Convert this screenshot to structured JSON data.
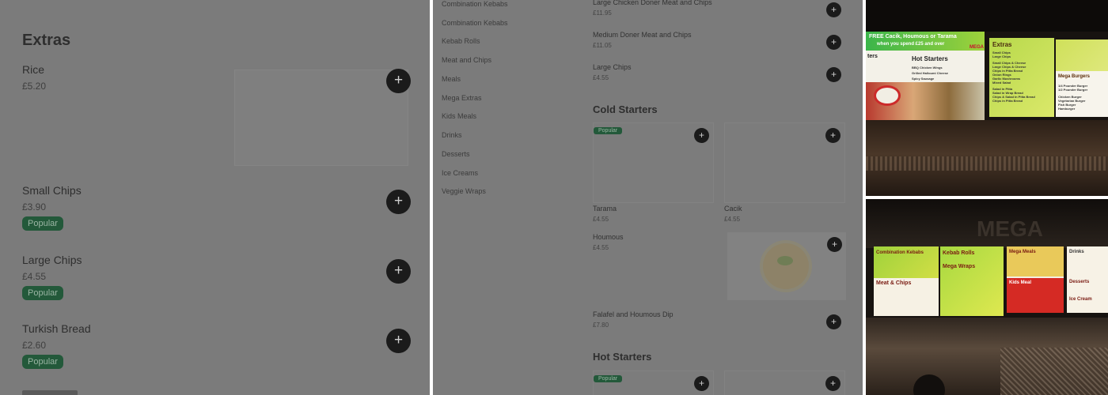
{
  "panel1": {
    "section_title": "Extras",
    "items": [
      {
        "name": "Rice",
        "price": "£5.20",
        "badge": ""
      },
      {
        "name": "Small Chips",
        "price": "£3.90",
        "badge": "Popular"
      },
      {
        "name": "Large Chips",
        "price": "£4.55",
        "badge": "Popular"
      },
      {
        "name": "Turkish Bread",
        "price": "£2.60",
        "badge": "Popular"
      }
    ],
    "add_icon": "+"
  },
  "panel2": {
    "categories": [
      "Combination Kebabs",
      "Combination Kebabs",
      "Kebab Rolls",
      "Meat and Chips",
      "Meals",
      "Mega Extras",
      "Kids Meals",
      "Drinks",
      "Desserts",
      "Ice Creams",
      "Veggie Wraps"
    ],
    "top_items": [
      {
        "name": "Large Chicken Doner Meat and Chips",
        "price": "£11.95"
      },
      {
        "name": "Medium Doner Meat and Chips",
        "price": "£11.05"
      },
      {
        "name": "Large Chips",
        "price": "£4.55"
      }
    ],
    "cold_starters_title": "Cold Starters",
    "cold_cards": [
      {
        "name": "Tarama",
        "price": "£4.55",
        "badge": "Popular"
      },
      {
        "name": "Cacik",
        "price": "£4.55",
        "badge": ""
      }
    ],
    "houmous": {
      "name": "Houmous",
      "price": "£4.55"
    },
    "falafel": {
      "name": "Falafel and Houmous Dip",
      "price": "£7.80"
    },
    "hot_starters_title": "Hot Starters",
    "hot_badge": "Popular",
    "add_icon": "+"
  },
  "photos": {
    "top": {
      "banner": "FREE Cacik, Houmous or Tarama",
      "banner2": "when you spend £25 and over",
      "mega": "MEGA",
      "hot_starters": "Hot Starters",
      "hot_lines": [
        "BBQ Chicken Wings",
        "Grilled Halloumi Cheese",
        "Spicy Sausage"
      ],
      "starters": "ters",
      "extras": "Extras",
      "extras_lines": [
        "Small Chips",
        "Large Chips",
        "Small Chips & Cheese",
        "Large Chips & Cheese",
        "Chips in Pitta Bread",
        "Onion Rings",
        "Garlic Mushrooms",
        "Mixed Salad",
        "Salad in Pitta",
        "Salad in Wrap Bread",
        "Chips & Salad in Pitta Bread",
        "Chips in Pitta Bread"
      ],
      "mega_burgers": "Mega Burgers",
      "burger_lines": [
        "1/4 Pounder Burger",
        "1/2 Pounder Burger",
        "Chicken Burger",
        "Vegetarian Burger",
        "Fish Burger",
        "Hamburger"
      ]
    },
    "bottom": {
      "combination": "Combination Kebabs",
      "meat_chips": "Meat & Chips",
      "kebab_rolls": "Kebab Rolls",
      "mega_wraps": "Mega Wraps",
      "mega_meals": "Mega Meals",
      "kids_meal": "Kids Meal",
      "drinks": "Drinks",
      "desserts": "Desserts",
      "ice_cream": "Ice Cream",
      "sign": "MEGA"
    }
  }
}
